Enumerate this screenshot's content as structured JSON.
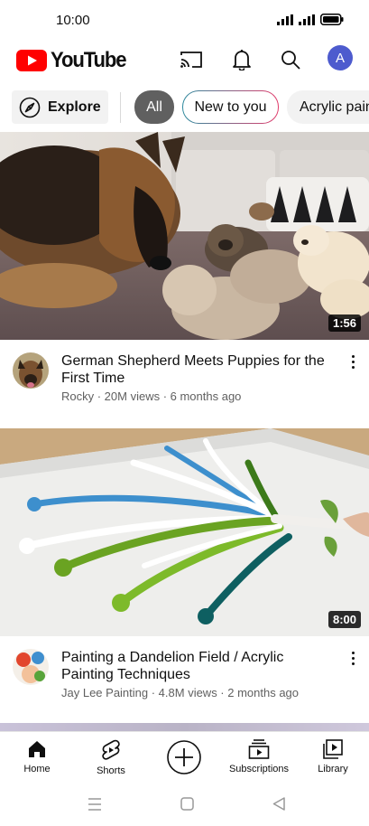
{
  "status": {
    "time": "10:00"
  },
  "header": {
    "logo_text": "YouTube",
    "avatar_letter": "A",
    "icons": [
      "cast-icon",
      "bell-icon",
      "search-icon"
    ]
  },
  "chips": {
    "explore": "Explore",
    "items": [
      "All",
      "New to you",
      "Acrylic paint"
    ]
  },
  "videos": [
    {
      "title": "German Shepherd Meets Puppies for the First Time",
      "sub": "Rocky · 20M views · 6 months ago",
      "duration": "1:56"
    },
    {
      "title": "Painting a Dandelion Field / Acrylic Painting Techniques",
      "sub": "Jay Lee Painting · 4.8M views · 2 months ago",
      "duration": "8:00"
    }
  ],
  "nav": {
    "home": "Home",
    "shorts": "Shorts",
    "subscriptions": "Subscriptions",
    "library": "Library"
  },
  "colors": {
    "brand_red": "#ff0000",
    "selected_chip": "#606060",
    "avatar": "#4d5bce"
  }
}
